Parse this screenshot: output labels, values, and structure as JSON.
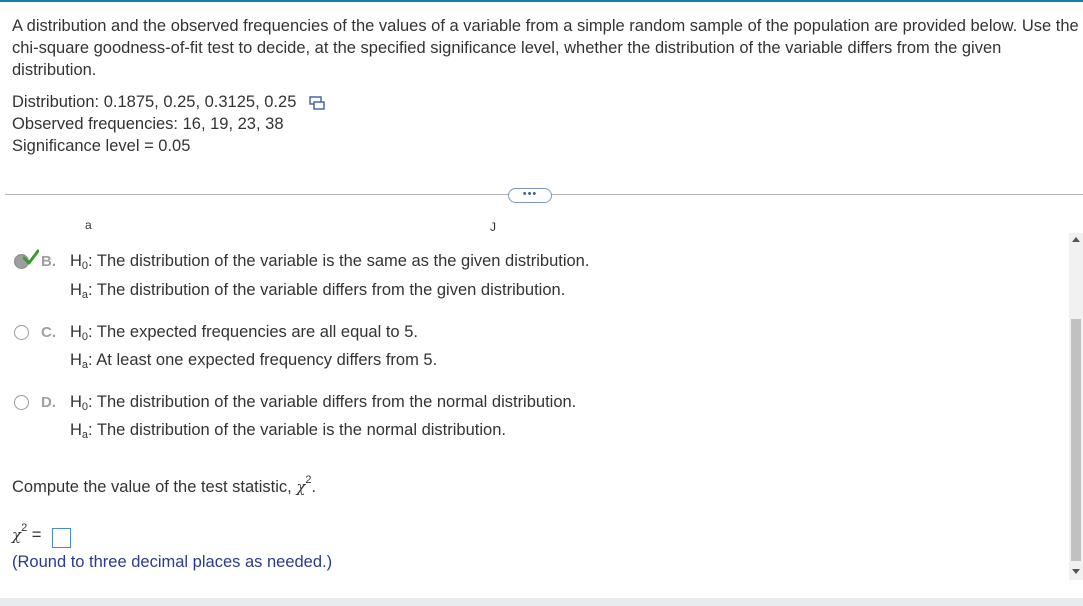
{
  "intro": {
    "text": "A distribution and the observed frequencies of the values of a variable from a simple random sample of the population are provided below. Use the chi-square goodness-of-fit test to decide, at the specified significance level, whether the distribution of the variable differs from the given distribution."
  },
  "givens": {
    "distribution": "Distribution: 0.1875, 0.25, 0.3125, 0.25",
    "observed": "Observed frequencies: 16, 19, 23, 38",
    "significance": "Significance level = 0.05"
  },
  "more_button": "•••",
  "cut_off": {
    "left": "a",
    "right": "J"
  },
  "options": [
    {
      "letter": "B.",
      "h0_label": "H",
      "h0_sub": "0",
      "h0": ": The distribution of the variable is the same as the given distribution.",
      "ha_label": "H",
      "ha_sub": "a",
      "ha": ": The distribution of the variable differs from the given distribution.",
      "selected": true
    },
    {
      "letter": "C.",
      "h0_label": "H",
      "h0_sub": "0",
      "h0": ": The expected frequencies are all equal to 5.",
      "ha_label": "H",
      "ha_sub": "a",
      "ha": ": At least one expected frequency differs from 5.",
      "selected": false
    },
    {
      "letter": "D.",
      "h0_label": "H",
      "h0_sub": "0",
      "h0": ": The distribution of the variable differs from the normal distribution.",
      "ha_label": "H",
      "ha_sub": "a",
      "ha": ": The distribution of the variable is the normal distribution.",
      "selected": false
    }
  ],
  "prompt": {
    "text": "Compute the value of the test statistic, ",
    "symbol": "χ",
    "exp": "2",
    "end": "."
  },
  "answer": {
    "symbol": "χ",
    "exp": "2",
    "eq": " =",
    "value": ""
  },
  "note": "(Round to three decimal places as needed.)",
  "colors": {
    "accent": "#1a7fa8",
    "check": "#3a9b35",
    "note": "#2b3a8f",
    "input_border": "#4b8ac8"
  }
}
